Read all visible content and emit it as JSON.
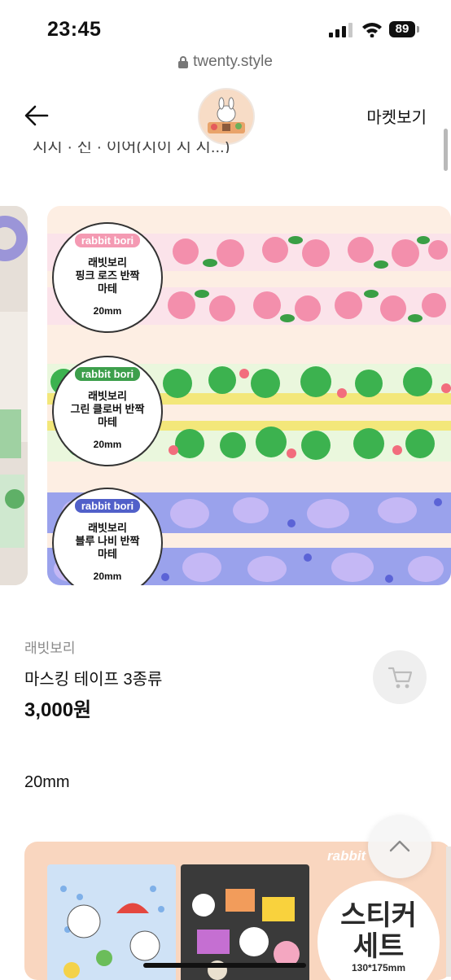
{
  "status": {
    "time": "23:45",
    "battery": "89"
  },
  "browser": {
    "url": "twenty.style"
  },
  "header": {
    "market_label": "마켓보기"
  },
  "cut_text": "시시 · 신 · 이어(시이 시 시...)",
  "tapes": [
    {
      "brand": "rabbit bori",
      "line1": "래빗보리",
      "line2": "핑크 로즈 반짝",
      "line3": "마테",
      "size": "20mm",
      "color": "#f7a8bd",
      "brand_color": "#f49ab3"
    },
    {
      "brand": "rabbit bori",
      "line1": "래빗보리",
      "line2": "그린 클로버 반짝",
      "line3": "마테",
      "size": "20mm",
      "color": "#3fb054",
      "brand_color": "#3d9f4c"
    },
    {
      "brand": "rabbit bori",
      "line1": "래빗보리",
      "line2": "블루 나비 반짝",
      "line3": "마테",
      "size": "20mm",
      "color": "#8c8ae6",
      "brand_color": "#5160c9"
    }
  ],
  "product": {
    "seller": "래빗보리",
    "name": "마스킹 테이프 3종류",
    "price": "3,000원",
    "size": "20mm"
  },
  "next_card": {
    "brand": "rabbit",
    "title_line1": "스티커",
    "title_line2": "세트",
    "size": "130*175mm"
  }
}
